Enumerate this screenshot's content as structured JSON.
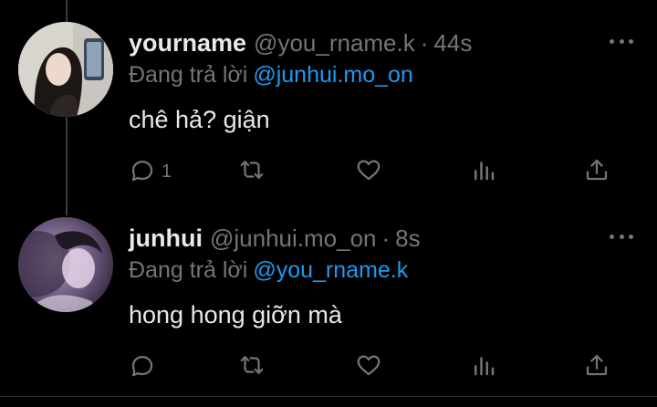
{
  "tweets": [
    {
      "display_name": "yourname",
      "handle": "@you_rname.k",
      "separator": "·",
      "time": "44s",
      "reply_prefix": "Đang trả lời",
      "reply_to": "@junhui.mo_on",
      "text": "chê hả? giận",
      "reply_count": "1"
    },
    {
      "display_name": "junhui",
      "handle": "@junhui.mo_on",
      "separator": "·",
      "time": "8s",
      "reply_prefix": "Đang trả lời",
      "reply_to": "@you_rname.k",
      "text": "hong hong giỡn mà",
      "reply_count": ""
    }
  ],
  "colors": {
    "background": "#000000",
    "text_primary": "#e7e9ea",
    "text_secondary": "#71767b",
    "accent": "#1d9bf0"
  },
  "icons": [
    "reply-icon",
    "retweet-icon",
    "like-icon",
    "views-icon",
    "share-icon",
    "more-icon"
  ]
}
